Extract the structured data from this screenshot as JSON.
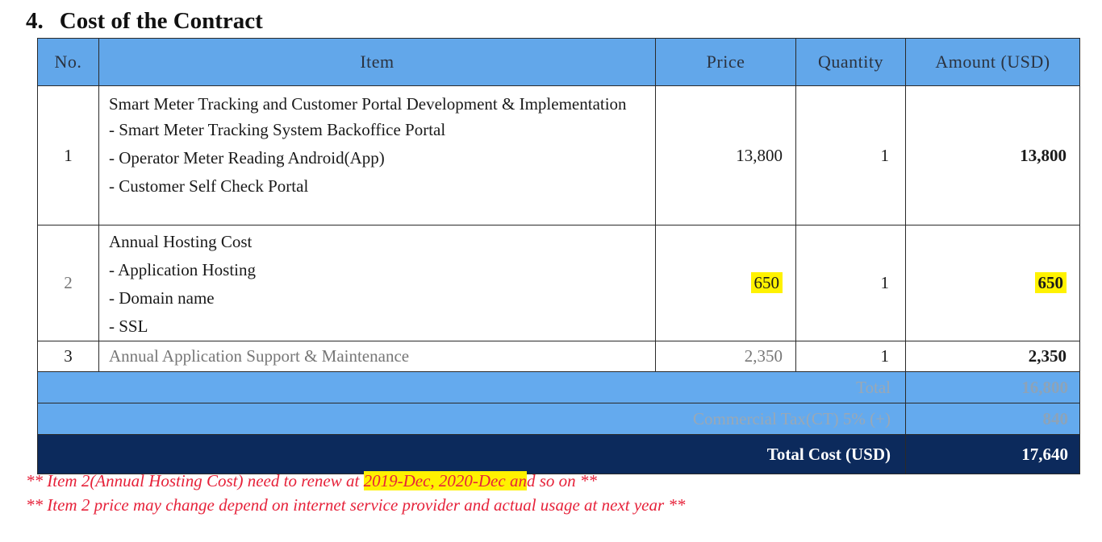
{
  "section": {
    "number": "4.",
    "title": "Cost of the Contract"
  },
  "table": {
    "headers": {
      "no": "No.",
      "item": "Item",
      "price": "Price",
      "quantity": "Quantity",
      "amount": "Amount (USD)"
    },
    "rows": [
      {
        "no": "1",
        "title": "Smart Meter Tracking and Customer Portal Development & Implementation",
        "lines": [
          "- Smart Meter Tracking System Backoffice Portal",
          "- Operator Meter Reading Android(App)",
          "- Customer Self Check Portal"
        ],
        "price": "13,800",
        "quantity": "1",
        "amount": "13,800"
      },
      {
        "no": "2",
        "title": "Annual Hosting Cost",
        "lines": [
          "- Application Hosting",
          "- Domain name",
          "- SSL"
        ],
        "price": "650",
        "quantity": "1",
        "amount": "650"
      },
      {
        "no": "3",
        "title": "Annual Application Support & Maintenance",
        "lines": [],
        "price": "2,350",
        "quantity": "1",
        "amount": "2,350"
      }
    ],
    "total": {
      "label": "Total",
      "value": "16,800"
    },
    "commercial_tax": {
      "label": "Commercial Tax(CT) 5% (+)",
      "value": "840"
    },
    "total_cost": {
      "label": "Total Cost (USD)",
      "value": "17,640"
    }
  },
  "notes": {
    "note1": {
      "before": "** Item 2(Annual Hosting Cost) need to renew at ",
      "highlight": "2019-Dec, 2020-Dec an",
      "after": "d so on **"
    },
    "note2": "** Item 2 price may change depend on internet service provider and actual usage at next year **"
  },
  "colors": {
    "header_bg": "#62a7ea",
    "total_cost_bg": "#0c2a5c",
    "highlight": "#fff200",
    "note_text": "#e6223a"
  }
}
